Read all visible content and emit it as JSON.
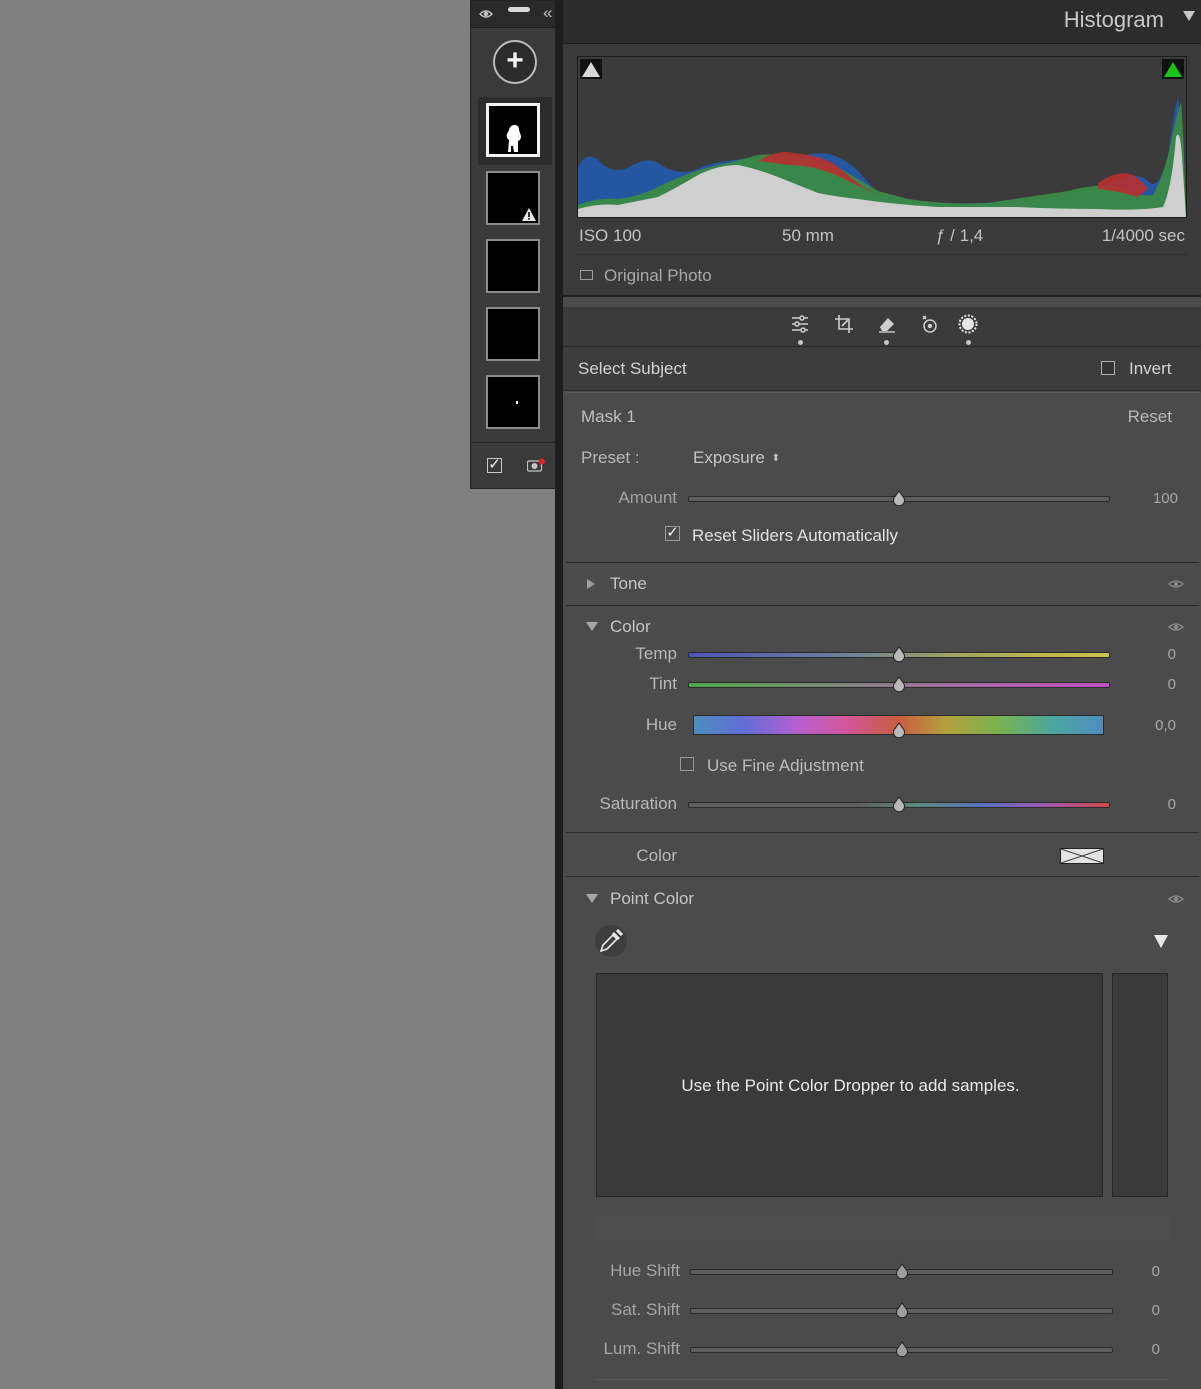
{
  "histogram": {
    "title": "Histogram",
    "iso": "ISO 100",
    "focal_length": "50 mm",
    "aperture": "ƒ / 1,4",
    "shutter": "1/4000 sec",
    "original_photo_label": "Original Photo"
  },
  "mask_panel": {
    "subject_label": "Select Subject",
    "invert_label": "Invert",
    "mask_name": "Mask 1",
    "reset_label": "Reset",
    "preset_label": "Preset :",
    "preset_value": "Exposure",
    "amount_label": "Amount",
    "amount_value": "100",
    "reset_sliders_label": "Reset Sliders Automatically"
  },
  "tone": {
    "title": "Tone"
  },
  "color_section": {
    "title": "Color",
    "temp_label": "Temp",
    "temp_value": "0",
    "tint_label": "Tint",
    "tint_value": "0",
    "hue_label": "Hue",
    "hue_value": "0,0",
    "fine_adjust_label": "Use Fine Adjustment",
    "saturation_label": "Saturation",
    "saturation_value": "0",
    "color_label": "Color"
  },
  "point_color": {
    "title": "Point Color",
    "message": "Use the Point Color Dropper to add samples.",
    "hue_shift_label": "Hue Shift",
    "hue_shift_value": "0",
    "sat_shift_label": "Sat. Shift",
    "sat_shift_value": "0",
    "lum_shift_label": "Lum. Shift",
    "lum_shift_value": "0"
  }
}
